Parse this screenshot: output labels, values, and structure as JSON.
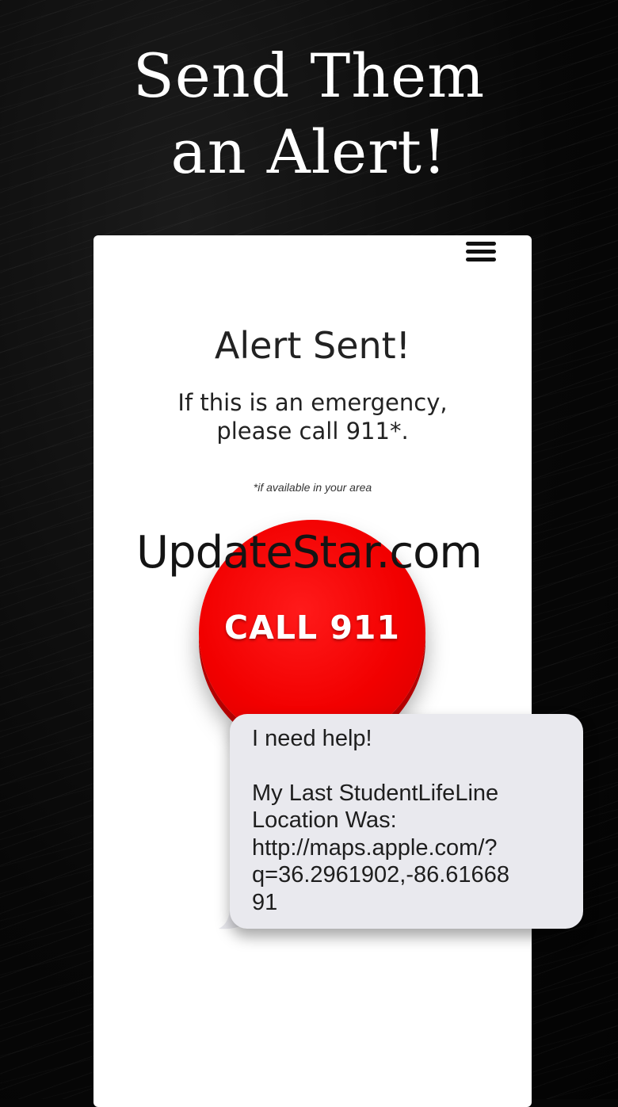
{
  "promo": {
    "headline_line1": "Send Them",
    "headline_line2": "an Alert!"
  },
  "screen": {
    "menu_icon": "hamburger-menu-icon",
    "title": "Alert Sent!",
    "emergency_line1": "If this is an emergency,",
    "emergency_line2": "please call 911*.",
    "footnote": "*if available in your area",
    "call_button_label": "CALL 911"
  },
  "watermark": "UpdateStar.com",
  "message": {
    "line1": "I need help!",
    "line2": "My Last StudentLifeLine",
    "line3": "Location Was:",
    "line4": "http://maps.apple.com/?",
    "line5": "q=36.2961902,-86.61668",
    "line6": "91"
  },
  "colors": {
    "background": "#060606",
    "card": "#ffffff",
    "call_button": "#f20000",
    "bubble": "#e9e9ee"
  }
}
